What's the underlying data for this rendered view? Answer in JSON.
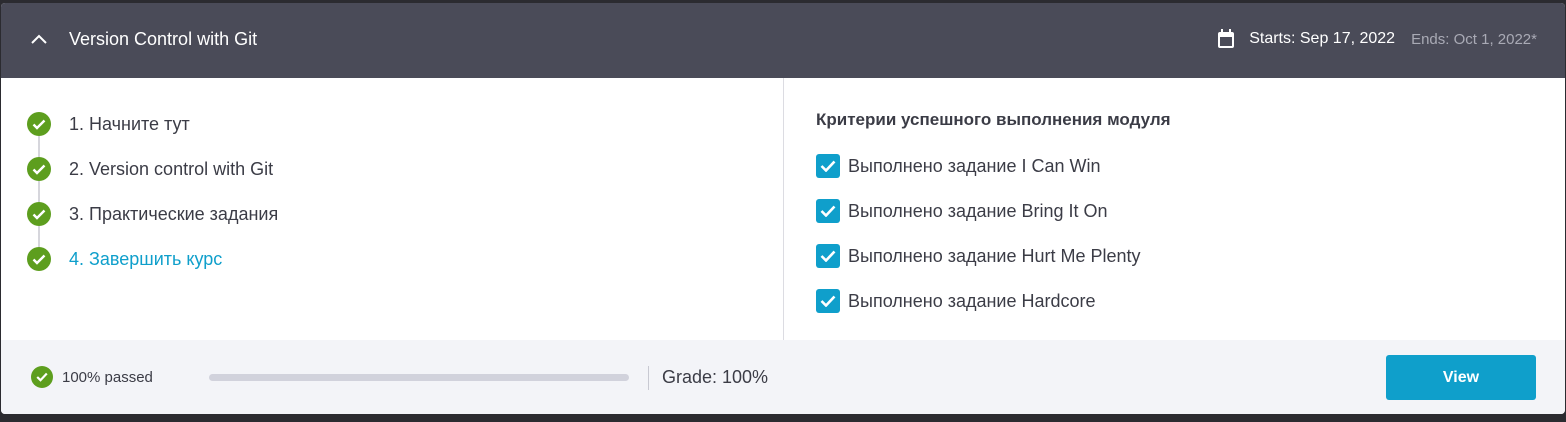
{
  "header": {
    "title": "Version Control with Git",
    "starts": "Starts: Sep 17, 2022",
    "ends": "Ends: Oct 1, 2022*"
  },
  "steps": [
    {
      "label": "1. Начните тут",
      "state": "done"
    },
    {
      "label": "2. Version control with Git",
      "state": "done"
    },
    {
      "label": "3. Практические задания",
      "state": "done"
    },
    {
      "label": "4. Завершить курс",
      "state": "active"
    }
  ],
  "criteria": {
    "title": "Критерии успешного выполнения модуля",
    "items": [
      {
        "label": "Выполнено задание I Can Win",
        "checked": true
      },
      {
        "label": "Выполнено задание Bring It On",
        "checked": true
      },
      {
        "label": "Выполнено задание Hurt Me Plenty",
        "checked": true
      },
      {
        "label": "Выполнено задание Hardcore",
        "checked": true
      }
    ]
  },
  "footer": {
    "passed_text": "100% passed",
    "progress": 1.0,
    "grade": "Grade: 100%",
    "view_label": "View"
  },
  "colors": {
    "header_bg": "#4a4b58",
    "accent": "#0f9fcb",
    "success": "#5d9e1e"
  }
}
